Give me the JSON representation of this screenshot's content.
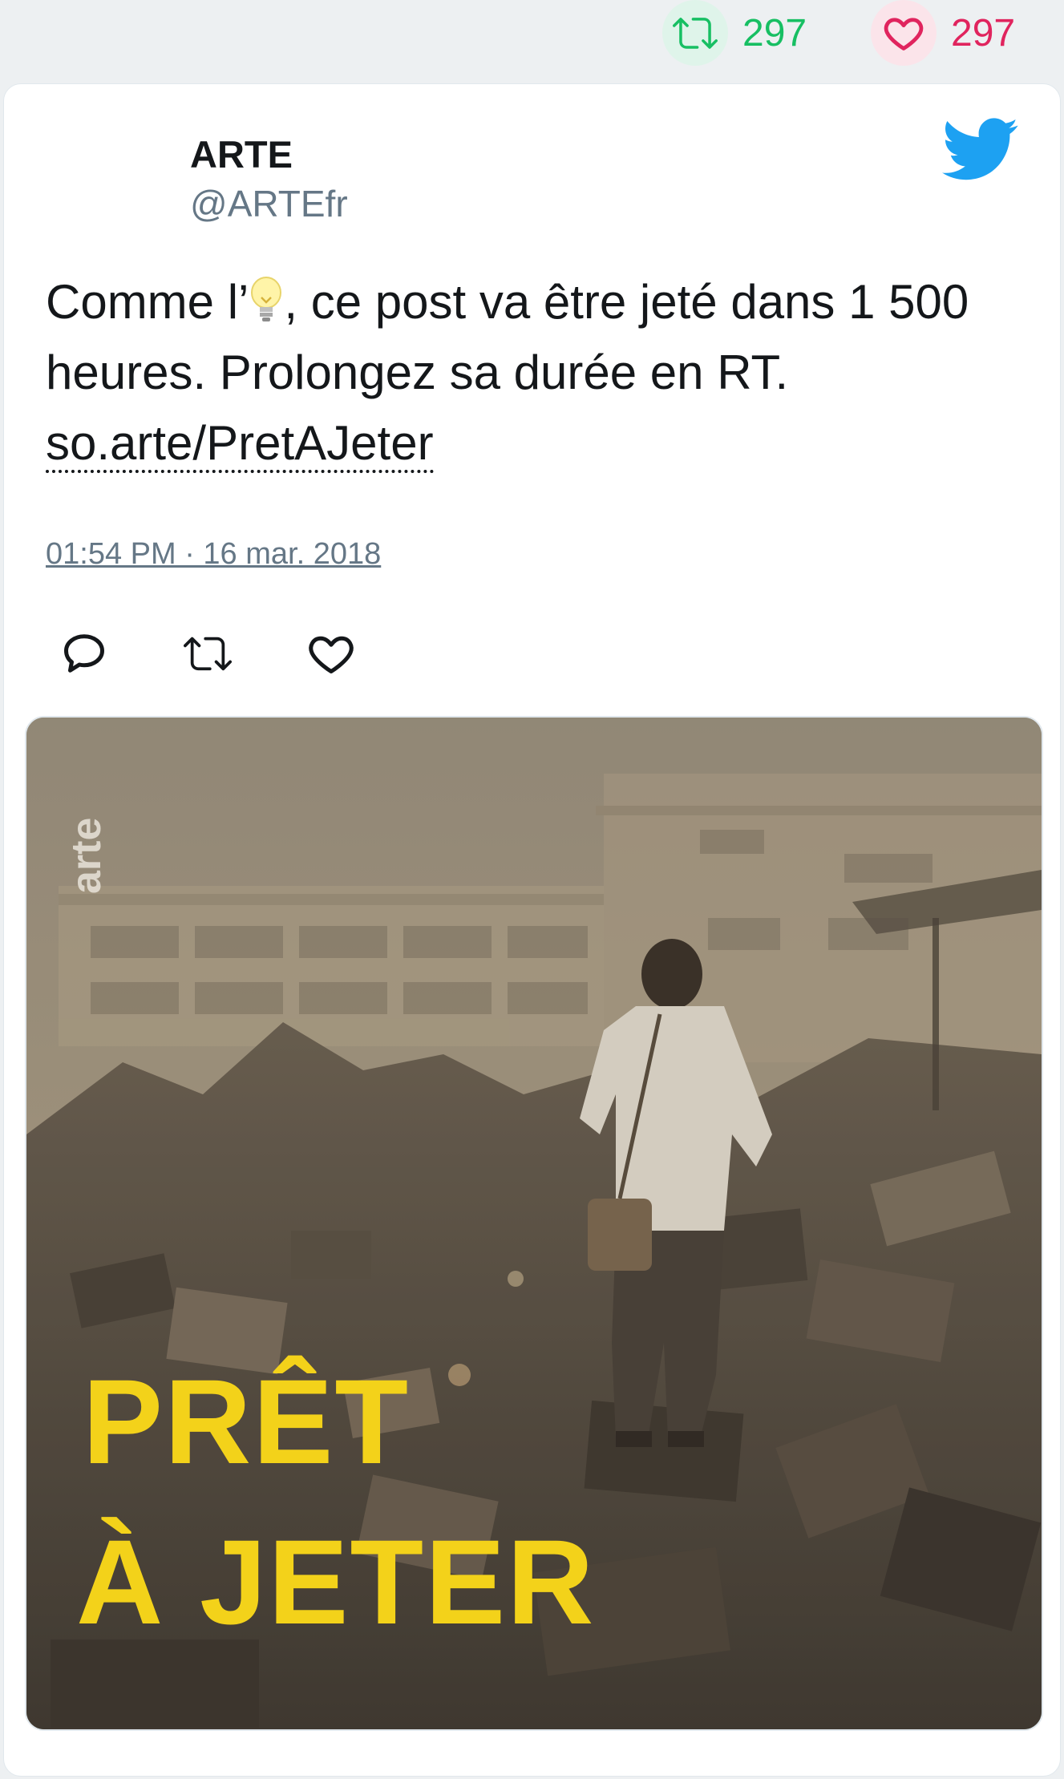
{
  "stats": {
    "retweet_count": "297",
    "like_count": "297",
    "retweet_icon": "retweet-icon",
    "like_icon": "heart-icon"
  },
  "tweet": {
    "display_name": "ARTE",
    "handle": "@ARTEfr",
    "text_before_emoji": "Comme l’",
    "emoji": "light-bulb",
    "text_after_emoji": ", ce post va être jeté dans 1 500 heures. Prolongez sa durée en RT.",
    "link": "so.arte/PretAJeter",
    "timestamp": "01:54 PM · 16 mar. 2018"
  },
  "actions": {
    "reply_icon": "reply-icon",
    "retweet_icon": "retweet-icon",
    "like_icon": "heart-icon"
  },
  "media": {
    "logo_text": "arte",
    "title_line1": "PRÊT",
    "title_line2": "À JETER",
    "description": "Man walking through a landfill of discarded electronics in haze"
  },
  "colors": {
    "retweet_green": "#17bf63",
    "like_red": "#e0245e",
    "twitter_blue": "#1da1f2",
    "title_yellow": "#f3d21a",
    "text": "#14171a",
    "secondary": "#657786"
  }
}
